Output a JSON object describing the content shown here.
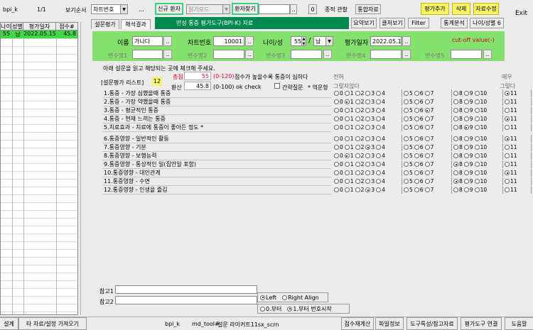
{
  "topbar": {
    "app_id": "bpi_k",
    "page_indicator": "1/1",
    "view_sort_label": "보기순서",
    "view_sort_value": "차트번호",
    "ellipsis": "...",
    "new_patient": "신규 환자",
    "read_mode": "읽기모드",
    "patient_search": "환자찾기",
    "patient_search_value": "",
    "zero_btn": "0",
    "integrated_view": "종적 관찰",
    "integrated_data": "통합자료",
    "add_eval": "평가추가",
    "delete": "삭제",
    "edit_data": "자료수정",
    "exit": "Exit"
  },
  "left_table": {
    "headers": [
      "나이",
      "성별",
      "평가일자",
      "점수#"
    ],
    "rows": [
      {
        "age": "55",
        "sex": "남",
        "date": "2022.05.15",
        "score": "45.8"
      }
    ]
  },
  "tabs": {
    "tab1": "설문평가",
    "tab2": "해석결과",
    "title": "만성 통증 평가도구(BPI-K) 자료",
    "summary": "요약보기",
    "clear": "클처보기",
    "filter": "Filter",
    "stats": "통계분석",
    "age_sex": "나이/성별 6"
  },
  "patient": {
    "name_label": "이름",
    "name_value": "가나다",
    "chart_label": "차트번호",
    "chart_value": "10001",
    "age_sex_label": "나이/성",
    "age_value": "55",
    "sex_value": "남",
    "eval_date_label": "평가일자",
    "eval_date_value": "2022.05.15",
    "cutoff": "cut-off value(-)",
    "var_labels": [
      "변수명1",
      "변수명2",
      "변수명3",
      "변수명4",
      "변수명5"
    ]
  },
  "instructions": "아래 설문을 읽고 해당되는 곳에 체크해 주세요.",
  "survey": {
    "list_label": "[설문평가 리스트]",
    "count": "12",
    "total_label": "총점",
    "total_value": "55",
    "total_range": "(0-120)",
    "total_note": "점수가 높을수록 통증이 심하다",
    "converted_label": "환산",
    "converted_value": "45.8",
    "converted_range": "(0-100) ok check",
    "brief_label": "간략질문",
    "reverse_label": "* 역문항",
    "scale_left_1": "전혀",
    "scale_left_2": "그렇지않다",
    "scale_right_1": "매우",
    "scale_right_2": "그렇다"
  },
  "questions": [
    {
      "text": "1.통증 - 가장 심했을때 통증",
      "selected": 11
    },
    {
      "text": "2.통증 - 가장 약했을때 통증",
      "selected": 1
    },
    {
      "text": "3.통증 - 평균적인 통증",
      "selected": 7
    },
    {
      "text": "4.통증 - 현재 느끼는 통증",
      "selected": 11
    },
    {
      "text": "5.치료효과 - 치료에 통증이 좋아든 정도 *",
      "selected": 9
    },
    {
      "text": "6.통증영향 - 일반적인 활동",
      "selected": 11
    },
    {
      "text": "7.통증영향 - 기분",
      "selected": 3
    },
    {
      "text": "8.통증영향 - 보행능력",
      "selected": 1
    },
    {
      "text": "9.통증영향 - 통상적인 일(집안일 포함)",
      "selected": 8
    },
    {
      "text": "10.통증영향 - 대인관계",
      "selected": 11
    },
    {
      "text": "11.통증영향 - 수면",
      "selected": 8
    },
    {
      "text": "12.통증영향 - 인생을 즐김",
      "selected": 3
    }
  ],
  "notes": {
    "note1": "참고1",
    "note2": "참고2",
    "left": "Left",
    "right_align": "Right Align",
    "start_zero": "0.부터",
    "start_one": "1.부터 번호시작"
  },
  "statusbar": {
    "settings": "설계",
    "other_data": "타 자료/설정 가져오기",
    "app_id": "bpi_k",
    "tool": "md_tool#",
    "desc": "설문 라이커트11sx_scrn",
    "recalc": "점수재계산",
    "file_info": "파일정보",
    "tool_ref": "도구특성/참고자료",
    "tool_link": "평가도구 연결",
    "help": "도움말"
  }
}
